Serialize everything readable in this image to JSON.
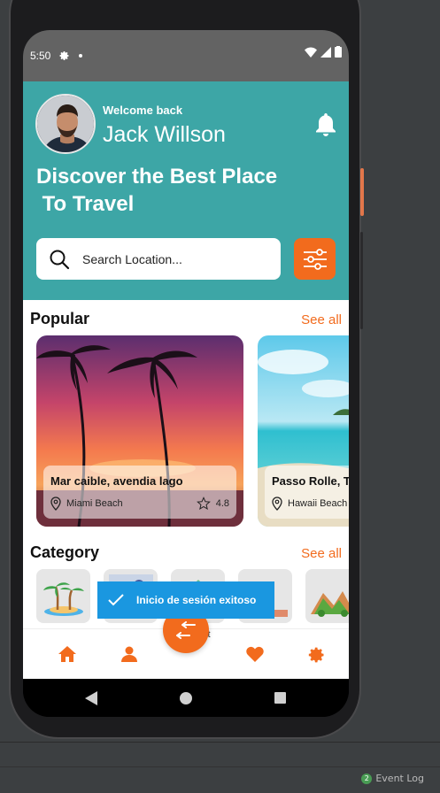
{
  "status_bar": {
    "time": "5:50"
  },
  "user": {
    "welcome": "Welcome back",
    "name": "Jack Willson"
  },
  "headline": "Discover the Best Place\n To Travel",
  "search": {
    "placeholder": "Search Location..."
  },
  "popular": {
    "title": "Popular",
    "see_all": "See all",
    "cards": [
      {
        "title": "Mar caible, avendia lago",
        "location": "Miami Beach",
        "rating": "4.8"
      },
      {
        "title": "Passo Rolle, TN",
        "location": "Hawaii Beach",
        "rating": ""
      }
    ]
  },
  "category": {
    "title": "Category",
    "see_all": "See all"
  },
  "toast": {
    "message": "Inicio de sesión exitoso"
  },
  "fab_label": "st",
  "ide": {
    "event_log": "Event Log",
    "event_count": "2"
  },
  "colors": {
    "accent": "#f26b1d",
    "header": "#3da6a6",
    "toast": "#1a97e0"
  },
  "icons": [
    "settings-icon",
    "bell-icon",
    "search-icon",
    "filter-icon",
    "location-pin-icon",
    "star-icon",
    "home-icon",
    "profile-icon",
    "heart-icon",
    "gear-icon"
  ]
}
